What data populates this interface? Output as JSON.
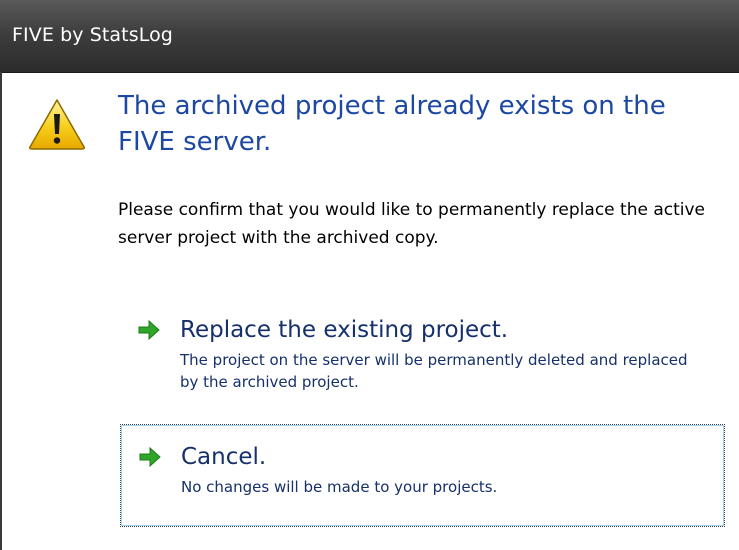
{
  "window": {
    "title": "FIVE by StatsLog"
  },
  "dialog": {
    "icon": "warning-icon",
    "main_instruction": "The archived project already exists on the FIVE server.",
    "content": "Please confirm that you would like to permanently replace the active server project with the archived copy.",
    "commands": [
      {
        "icon": "green-arrow-icon",
        "label": "Replace the existing project.",
        "note": "The project on the server will be permanently deleted and replaced by the archived project."
      },
      {
        "icon": "green-arrow-icon",
        "label": "Cancel.",
        "note": "No changes will be made to your projects.",
        "focused": true
      }
    ]
  },
  "colors": {
    "title_bar": "#3e3e3e",
    "instruction_text": "#1c48a3",
    "command_text": "#16306b",
    "arrow_green": "#2fa52a",
    "warning_yellow": "#f5c400"
  }
}
